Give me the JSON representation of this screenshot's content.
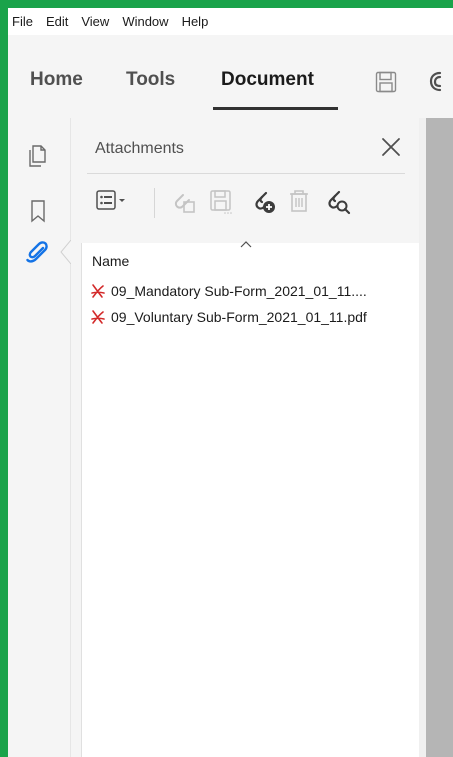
{
  "menu": [
    "File",
    "Edit",
    "View",
    "Window",
    "Help"
  ],
  "tabs": [
    {
      "label": "Home",
      "active": false
    },
    {
      "label": "Tools",
      "active": false
    },
    {
      "label": "Document",
      "active": true
    }
  ],
  "panel": {
    "title": "Attachments",
    "column_name": "Name",
    "files": [
      "09_Mandatory Sub-Form_2021_01_11....",
      "09_Voluntary Sub-Form_2021_01_11.pdf"
    ]
  },
  "colors": {
    "frame_green": "#1aa34a",
    "accent_blue": "#1473e6",
    "pdf_red": "#d32a2a"
  }
}
